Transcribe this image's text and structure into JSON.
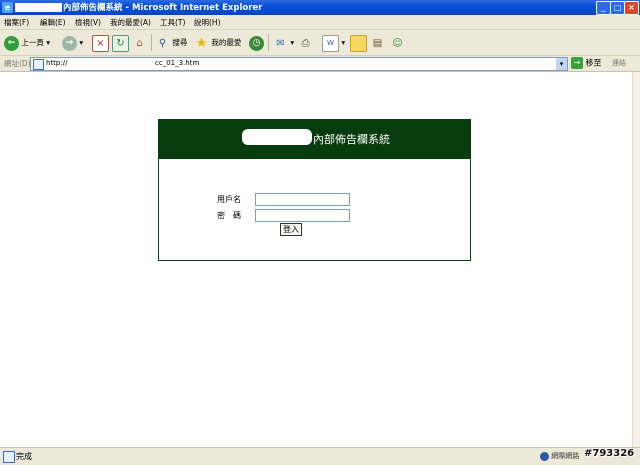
{
  "window": {
    "title": "內部佈告欄系統 - Microsoft Internet Explorer"
  },
  "menu": [
    "檔案(F)",
    "編輯(E)",
    "檢視(V)",
    "我的最愛(A)",
    "工具(T)",
    "說明(H)"
  ],
  "toolbar": {
    "back_label": "上一頁",
    "search_label": "搜尋",
    "favorites_label": "我的最愛"
  },
  "address": {
    "label": "網址(D)",
    "url_start": "http://",
    "url_end": "cc_01_3.htm",
    "go_label": "移至",
    "links_label": "連結"
  },
  "panel": {
    "title": "內部佈告欄系統"
  },
  "form": {
    "username_label": "用戶名",
    "password_label": "密　碼",
    "username_value": "",
    "password_value": "",
    "login_label": "登入"
  },
  "status": {
    "text": "完成",
    "zone": "網際網路",
    "watermark": "#793326"
  }
}
